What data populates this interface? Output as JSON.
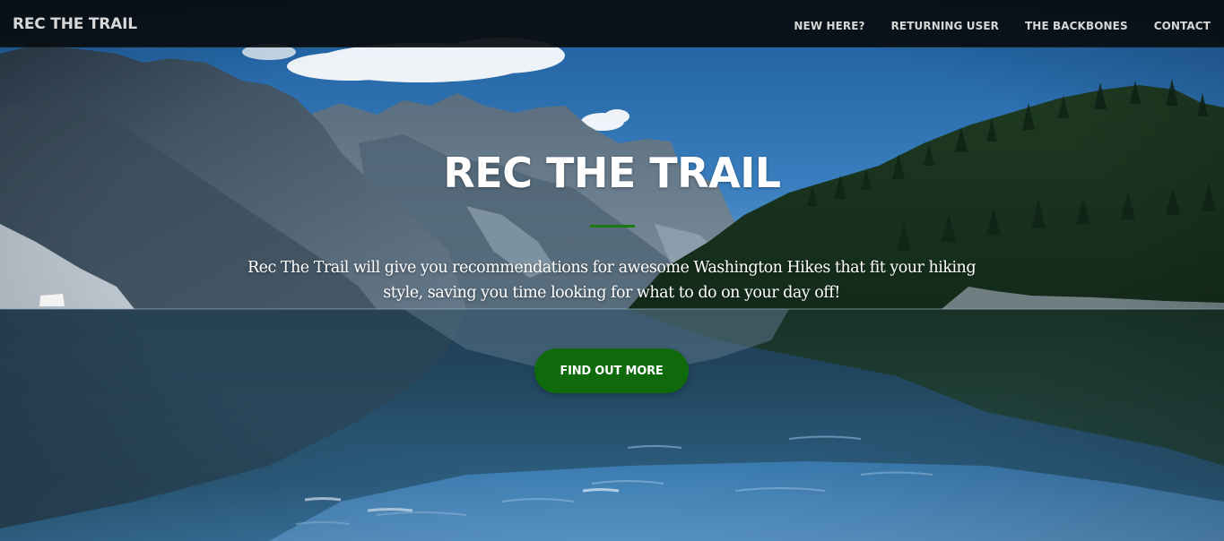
{
  "navbar": {
    "brand": "REC THE TRAIL",
    "links": [
      {
        "label": "NEW HERE?"
      },
      {
        "label": "RETURNING USER"
      },
      {
        "label": "THE BACKBONES"
      },
      {
        "label": "CONTACT"
      }
    ]
  },
  "hero": {
    "title": "REC THE TRAIL",
    "description": "Rec The Trail will give you recommendations for awesome Washington Hikes that fit your hiking style, saving you time looking for what to do on your day off!",
    "cta_label": "FIND OUT MORE",
    "background_image": "mountain lake landscape with forested ridges and reflections"
  },
  "colors": {
    "navbar_bg": "#080c10",
    "nav_text": "#d7d7d7",
    "accent_green": "#0f6a0c",
    "divider_green": "#1d7a12",
    "hero_text": "#ffffff"
  }
}
